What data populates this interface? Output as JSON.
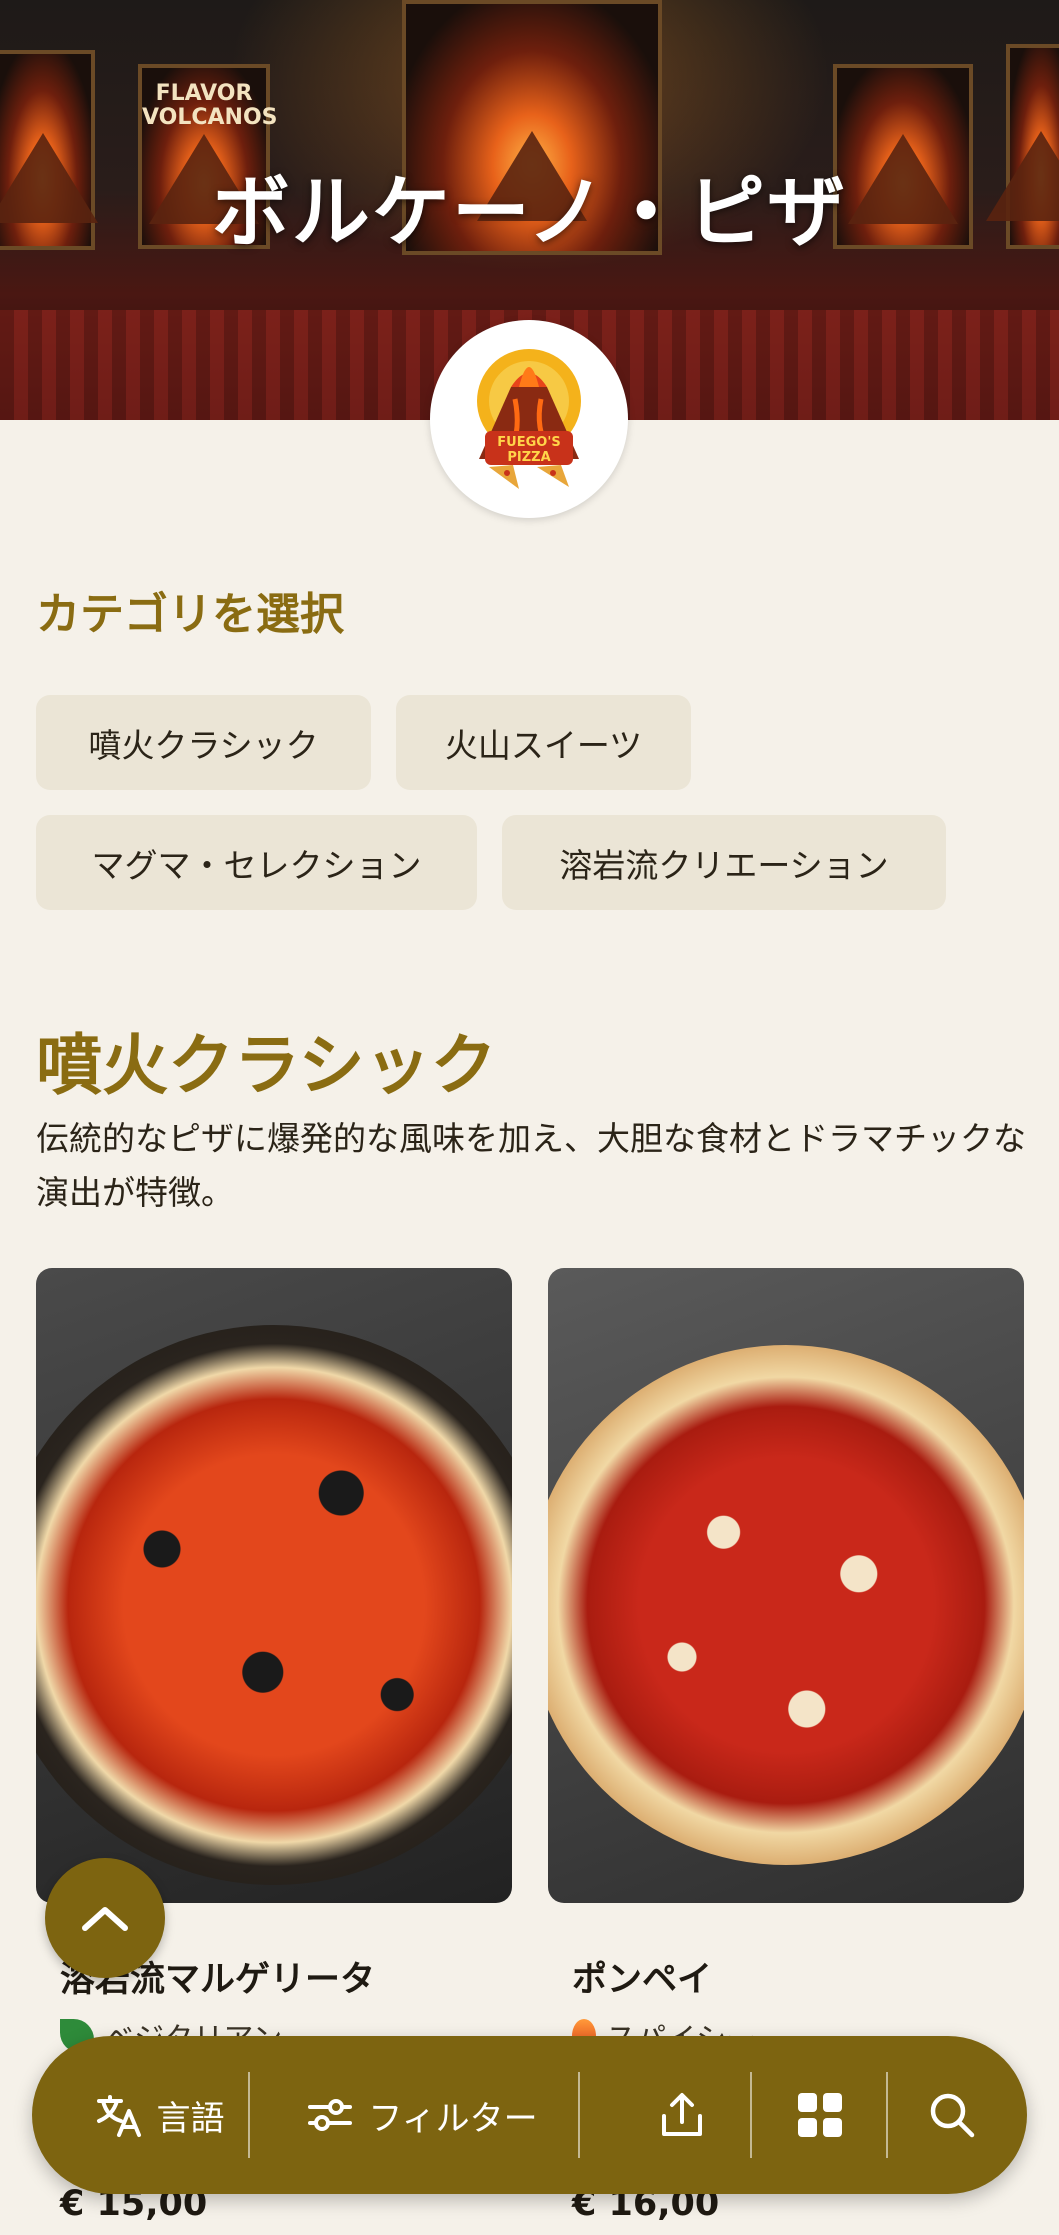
{
  "restaurant": {
    "title": "ボルケーノ・ピザ",
    "poster_text": "FLAVOR VOLCANOS"
  },
  "logo": {
    "text_line1": "FUEGO'S",
    "text_line2": "PIZZA"
  },
  "categories": {
    "heading": "カテゴリを選択",
    "items": [
      {
        "label": "噴火クラシック"
      },
      {
        "label": "火山スイーツ"
      },
      {
        "label": "マグマ・セレクション"
      },
      {
        "label": "溶岩流クリエーション"
      }
    ]
  },
  "section": {
    "title": "噴火クラシック",
    "description": "伝統的なピザに爆発的な風味を加え、大胆な食材とドラマチックな演出が特徴。"
  },
  "products": [
    {
      "name": "溶岩流マルゲリータ",
      "tag": "ベジタリアン",
      "tag_icon": "leaf-icon",
      "price": "€ 15,00"
    },
    {
      "name": "ポンペイ",
      "tag": "スパイシー",
      "tag_icon": "flame-icon",
      "price": "€ 16,00"
    }
  ],
  "bottom_bar": {
    "language_label": "言語",
    "filter_label": "フィルター"
  },
  "colors": {
    "accent": "#7d6410",
    "heading": "#8a6c12",
    "background": "#f5f1e9",
    "chip": "#ebe5d6"
  }
}
